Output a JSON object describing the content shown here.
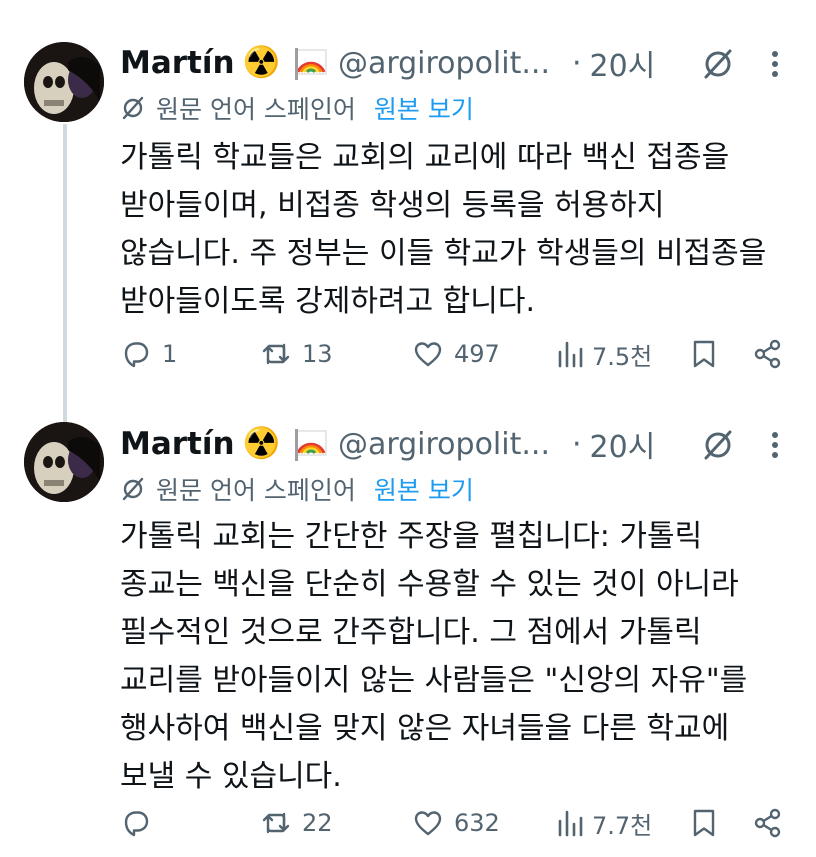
{
  "tweets": [
    {
      "author_name": "Martín",
      "badge_emoji": "☢️",
      "flag_emoji": "🏳️‍🌈",
      "handle": "@argiropolit...",
      "separator": "·",
      "time": "20시",
      "translated_from": "원문 언어 스페인어",
      "view_original": "원본 보기",
      "lines": [
        "가톨릭 학교들은 교회의 교리에 따라 백신 접종을",
        "받아들이며, 비접종 학생의 등록을 허용하지",
        "않습니다. 주 정부는 이들 학교가 학생들의 비접종을",
        "받아들이도록 강제하려고 합니다."
      ],
      "replies": "1",
      "retweets": "13",
      "likes": "497",
      "views": "7.5천"
    },
    {
      "author_name": "Martín",
      "badge_emoji": "☢️",
      "flag_emoji": "🏳️‍🌈",
      "handle": "@argiropolit...",
      "separator": "·",
      "time": "20시",
      "translated_from": "원문 언어 스페인어",
      "view_original": "원본 보기",
      "lines": [
        "가톨릭 교회는 간단한 주장을 펼칩니다: 가톨릭",
        "종교는 백신을 단순히 수용할 수 있는 것이 아니라",
        "필수적인 것으로 간주합니다. 그 점에서 가톨릭",
        "교리를 받아들이지 않는 사람들은 \"신앙의 자유\"를",
        "행사하여 백신을 맞지 않은 자녀들을 다른 학교에",
        "보낼 수 있습니다."
      ],
      "replies": "",
      "retweets": "22",
      "likes": "632",
      "views": "7.7천"
    }
  ],
  "colors": {
    "text": "#0f1419",
    "muted": "#536471",
    "link": "#1d9bf0",
    "thread_line": "#cfd9de",
    "radiation_badge": "#f5c518"
  },
  "icons": [
    "translate-icon",
    "grok-slash-icon",
    "more-icon",
    "reply-icon",
    "retweet-icon",
    "like-icon",
    "views-icon",
    "bookmark-icon",
    "share-icon"
  ]
}
